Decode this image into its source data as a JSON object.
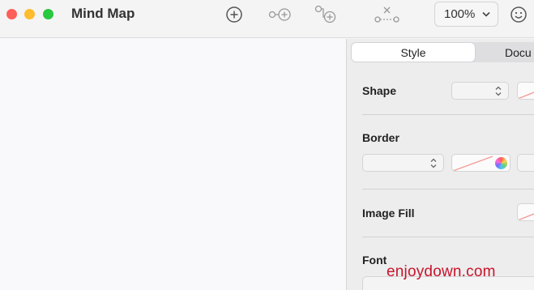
{
  "window": {
    "title": "Mind Map"
  },
  "toolbar": {
    "icons": [
      "add-topic-icon",
      "add-subtopic-icon",
      "add-child-topic-icon",
      "delete-connection-icon",
      "emoji-icon"
    ],
    "zoom": "100%"
  },
  "inspector": {
    "tabs": [
      {
        "label": "Style",
        "selected": true
      },
      {
        "label": "Docu",
        "selected": false
      }
    ],
    "sections": {
      "shape": "Shape",
      "border": "Border",
      "image_fill": "Image Fill",
      "font": "Font"
    },
    "colors": {
      "none_slash": "#f29a96",
      "accent_selected_tab": "#ffffff"
    }
  },
  "watermark": "enjoydown.com"
}
